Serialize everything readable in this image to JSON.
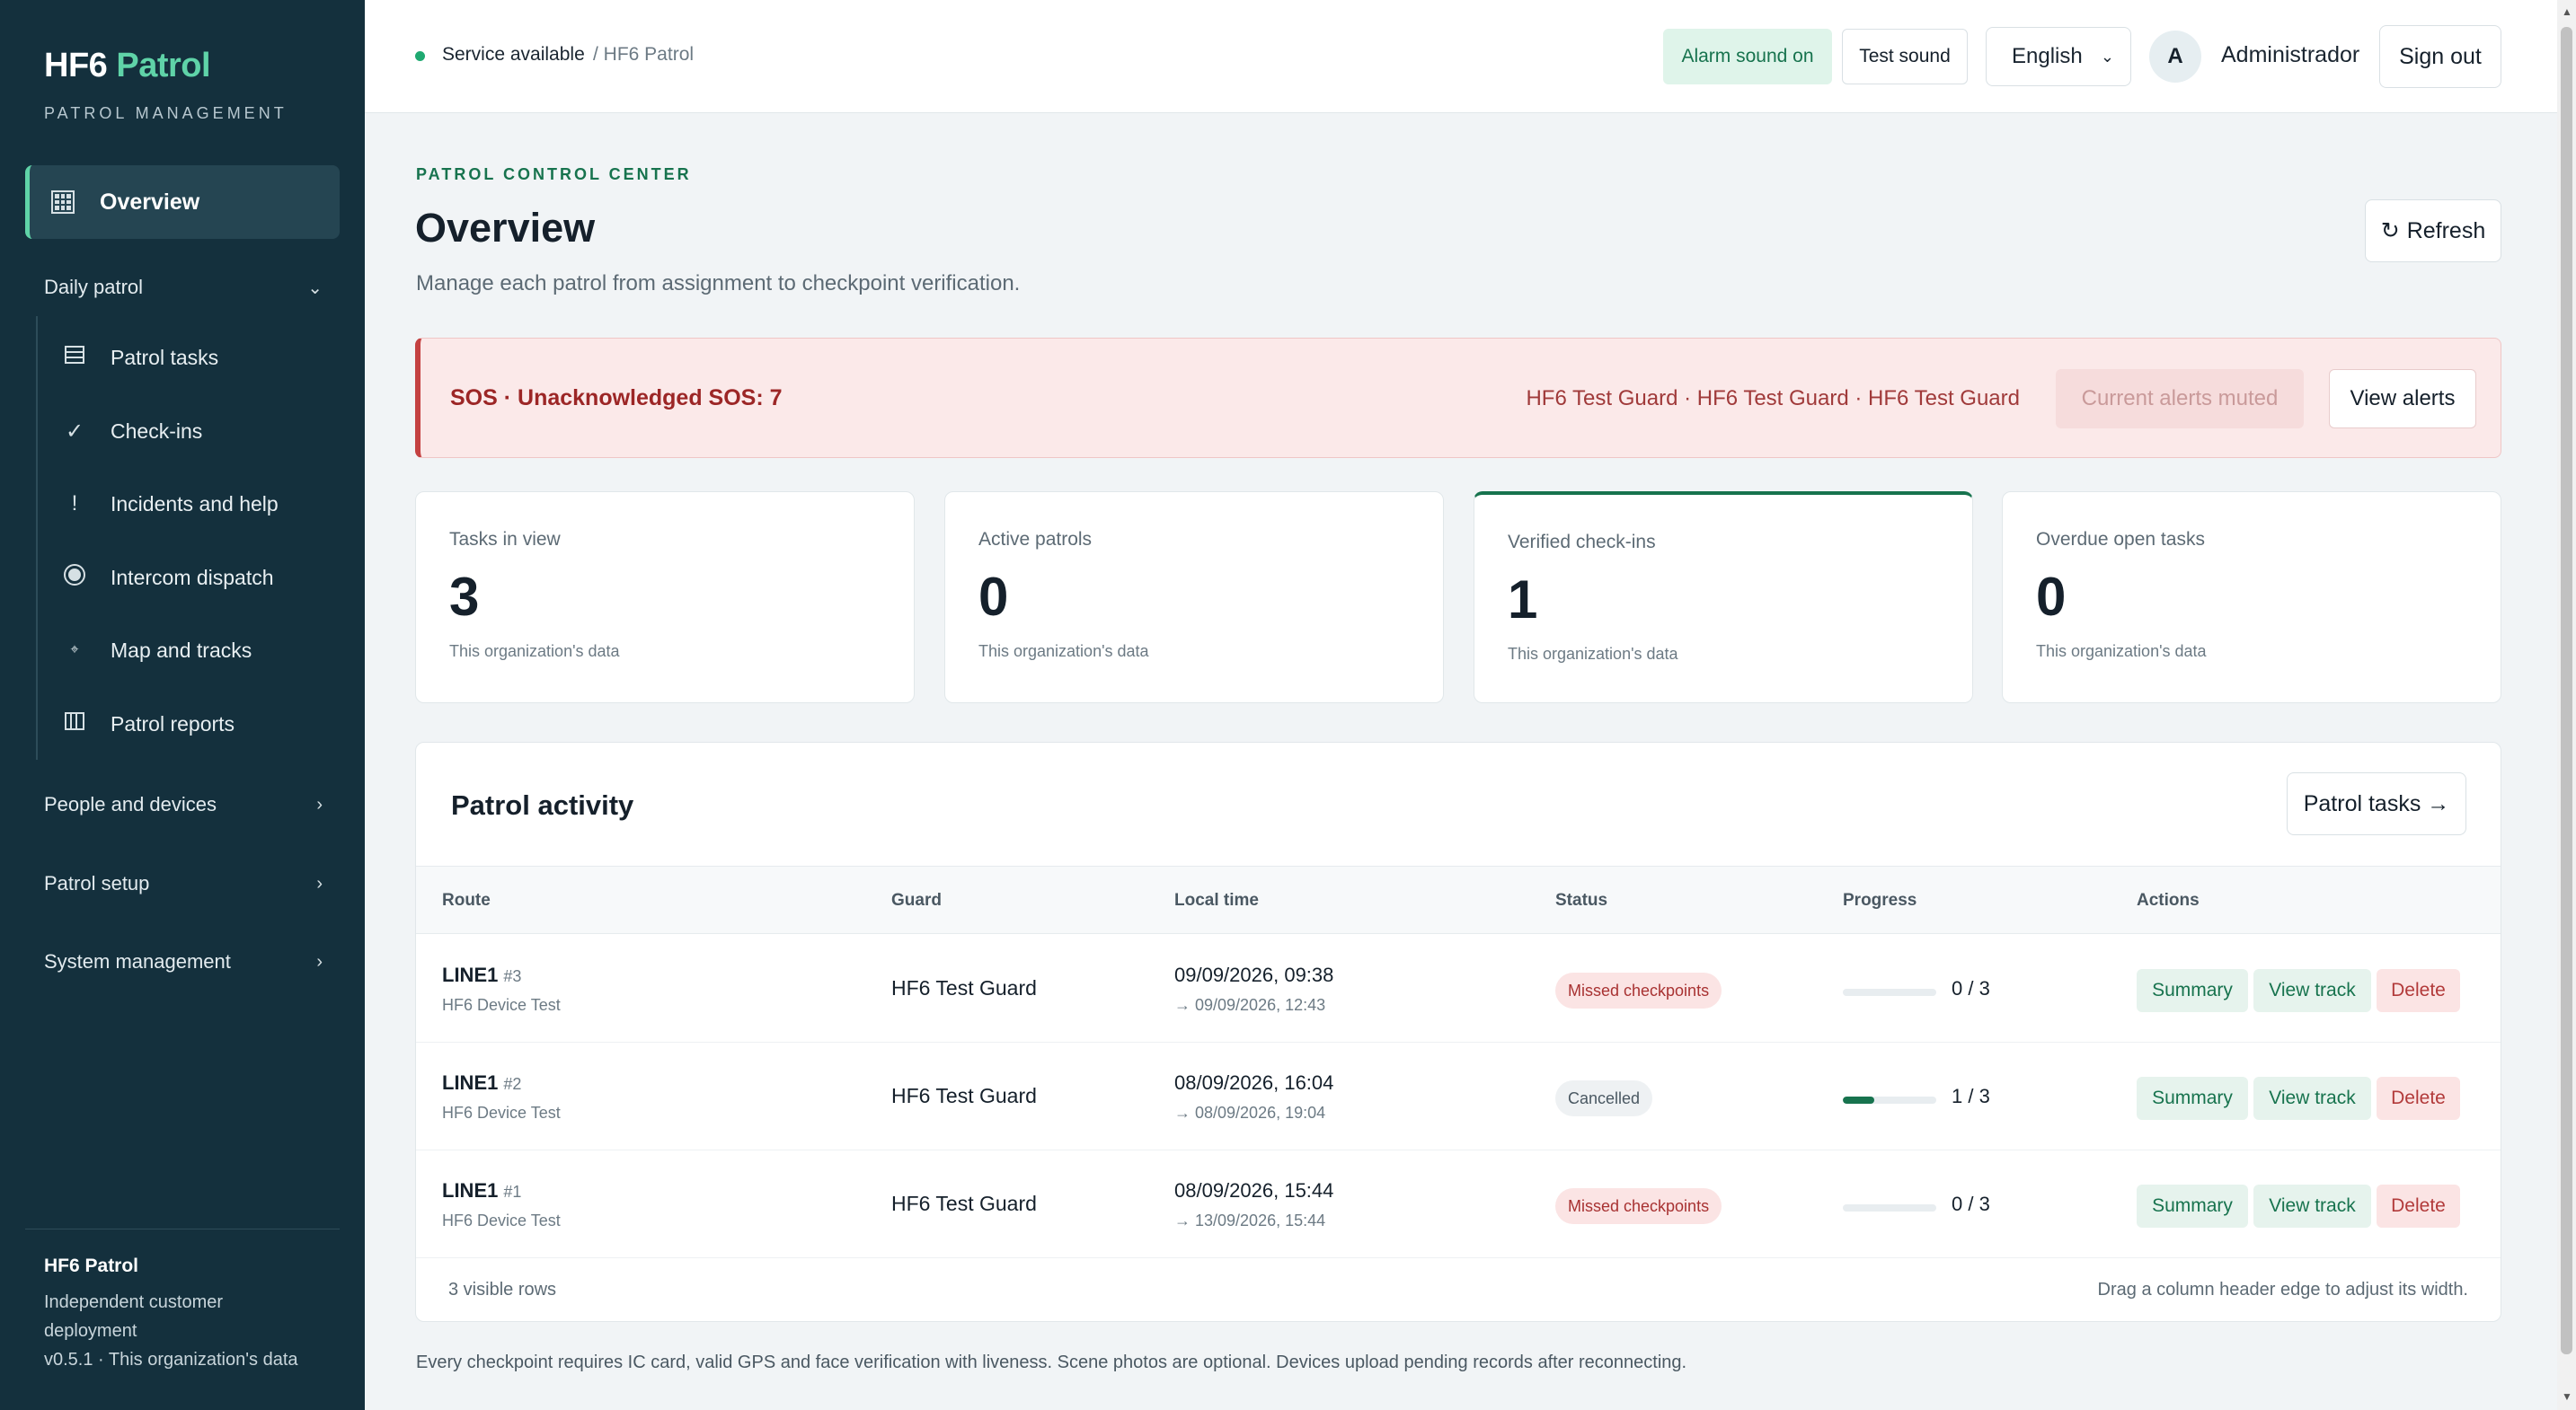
{
  "sidebar": {
    "brand_main": "HF6",
    "brand_accent": "Patrol",
    "brand_subtitle": "PATROL MANAGEMENT",
    "active_item": "Overview",
    "groups": {
      "daily": "Daily patrol",
      "people": "People and devices",
      "setup": "Patrol setup",
      "system": "System management"
    },
    "daily_items": [
      {
        "label": "Patrol tasks",
        "icon": "list-icon"
      },
      {
        "label": "Check-ins",
        "icon": "check-icon"
      },
      {
        "label": "Incidents and help",
        "icon": "exclamation-icon"
      },
      {
        "label": "Intercom dispatch",
        "icon": "radio-icon"
      },
      {
        "label": "Map and tracks",
        "icon": "location-icon"
      },
      {
        "label": "Patrol reports",
        "icon": "report-icon"
      }
    ],
    "footer": {
      "title": "HF6 Patrol",
      "line1": "Independent customer deployment",
      "line2": "v0.5.1 · This organization's data"
    }
  },
  "topbar": {
    "status": "Service available",
    "breadcrumb": "/ HF6 Patrol",
    "alarm": "Alarm sound on",
    "test_sound": "Test sound",
    "language": "English",
    "avatar_initial": "A",
    "user": "Administrador",
    "sign_out": "Sign out"
  },
  "header": {
    "eyebrow": "PATROL CONTROL CENTER",
    "title": "Overview",
    "description": "Manage each patrol from assignment to checkpoint verification.",
    "refresh": "Refresh"
  },
  "sos": {
    "title": "SOS · Unacknowledged SOS: 7",
    "guards": "HF6 Test Guard · HF6 Test Guard · HF6 Test Guard",
    "muted": "Current alerts muted",
    "view": "View alerts"
  },
  "stats": [
    {
      "label": "Tasks in view",
      "value": "3",
      "foot": "This organization's data"
    },
    {
      "label": "Active patrols",
      "value": "0",
      "foot": "This organization's data"
    },
    {
      "label": "Verified check-ins",
      "value": "1",
      "foot": "This organization's data"
    },
    {
      "label": "Overdue open tasks",
      "value": "0",
      "foot": "This organization's data"
    }
  ],
  "activity": {
    "title": "Patrol activity",
    "tasks_link": "Patrol tasks →",
    "columns": [
      "Route",
      "Guard",
      "Local time",
      "Status",
      "Progress",
      "Actions"
    ],
    "rows": [
      {
        "route": "LINE1",
        "num": "#3",
        "device": "HF6 Device Test",
        "guard": "HF6 Test Guard",
        "start": "09/09/2026, 09:38",
        "end": "→ 09/09/2026, 12:43",
        "status": "Missed checkpoints",
        "done": 0,
        "total": 3,
        "progress": "0 / 3",
        "summary": "Summary",
        "track": "View track",
        "delete": "Delete"
      },
      {
        "route": "LINE1",
        "num": "#2",
        "device": "HF6 Device Test",
        "guard": "HF6 Test Guard",
        "start": "08/09/2026, 16:04",
        "end": "→ 08/09/2026, 19:04",
        "status": "Cancelled",
        "done": 1,
        "total": 3,
        "progress": "1 / 3",
        "summary": "Summary",
        "track": "View track",
        "delete": "Delete"
      },
      {
        "route": "LINE1",
        "num": "#1",
        "device": "HF6 Device Test",
        "guard": "HF6 Test Guard",
        "start": "08/09/2026, 15:44",
        "end": "→ 13/09/2026, 15:44",
        "status": "Missed checkpoints",
        "done": 0,
        "total": 3,
        "progress": "0 / 3",
        "summary": "Summary",
        "track": "View track",
        "delete": "Delete"
      }
    ],
    "footer_left": "3 visible rows",
    "footer_right": "Drag a column header edge to adjust its width."
  },
  "bottom_note": "Every checkpoint requires IC card, valid GPS and face verification with liveness. Scene photos are optional. Devices upload pending records after reconnecting.",
  "colors": {
    "sidebar": "#14303d",
    "accent": "#5fd3a8",
    "primary": "#17734e",
    "danger": "#c44141"
  }
}
